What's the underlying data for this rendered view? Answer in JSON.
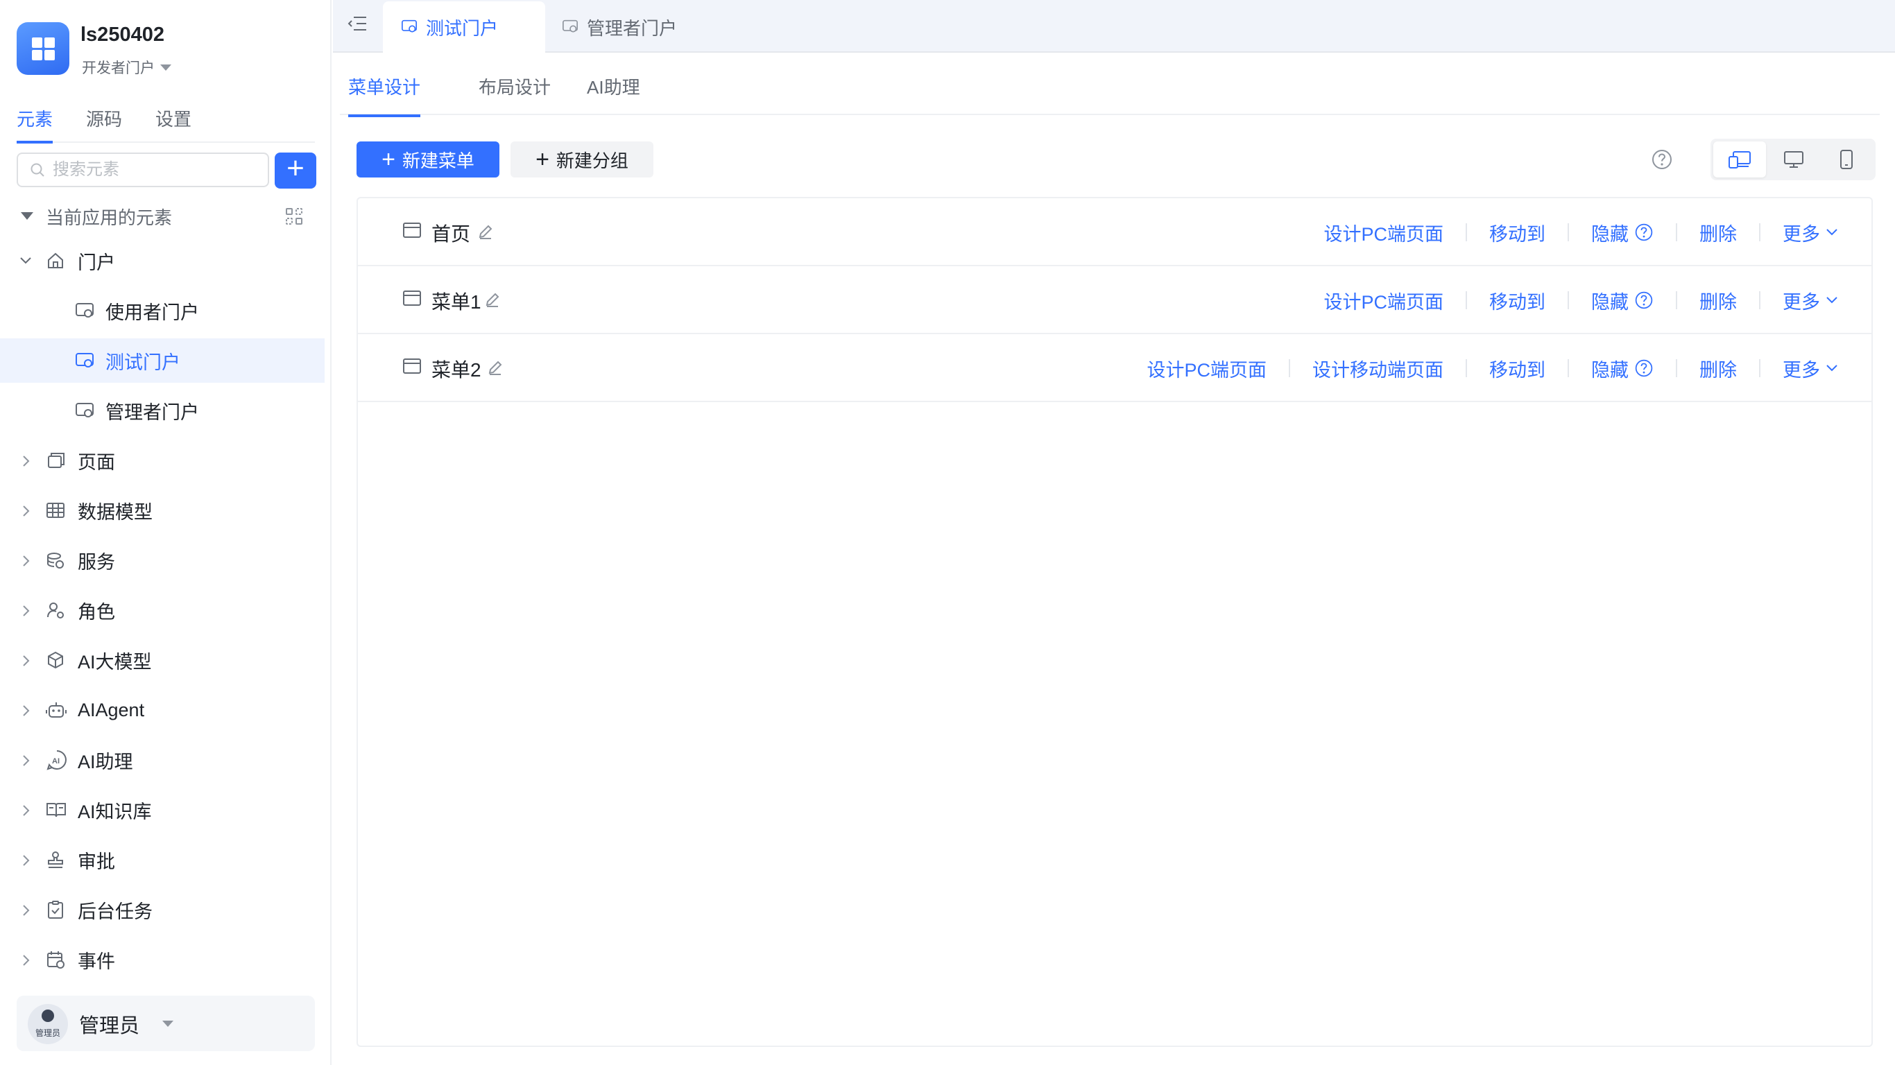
{
  "app": {
    "name": "ls250402",
    "portal": "开发者门户"
  },
  "sidebar_tabs": [
    "元素",
    "源码",
    "设置"
  ],
  "search": {
    "placeholder": "搜索元素"
  },
  "tree": {
    "group_label": "当前应用的元素",
    "portal_label": "门户",
    "portals": [
      "使用者门户",
      "测试门户",
      "管理者门户"
    ],
    "sections": [
      "页面",
      "数据模型",
      "服务",
      "角色",
      "AI大模型",
      "AIAgent",
      "AI助理",
      "AI知识库",
      "审批",
      "后台任务",
      "事件"
    ]
  },
  "user": {
    "name": "管理员",
    "avatar_tag": "管理员"
  },
  "doc_tabs": [
    "测试门户",
    "管理者门户"
  ],
  "sub_tabs": [
    "菜单设计",
    "布局设计",
    "AI助理"
  ],
  "toolbar": {
    "new_menu": "新建菜单",
    "new_group": "新建分组"
  },
  "actions": {
    "design_pc": "设计PC端页面",
    "design_mobile": "设计移动端页面",
    "move_to": "移动到",
    "hide": "隐藏",
    "delete": "删除",
    "more": "更多"
  },
  "menus": [
    {
      "name": "首页"
    },
    {
      "name": "菜单1"
    },
    {
      "name": "菜单2"
    }
  ],
  "colors": {
    "accent": "#3370ff",
    "selected_bg": "#eef3fe",
    "tab_bar_bg": "#f1f4fa"
  }
}
